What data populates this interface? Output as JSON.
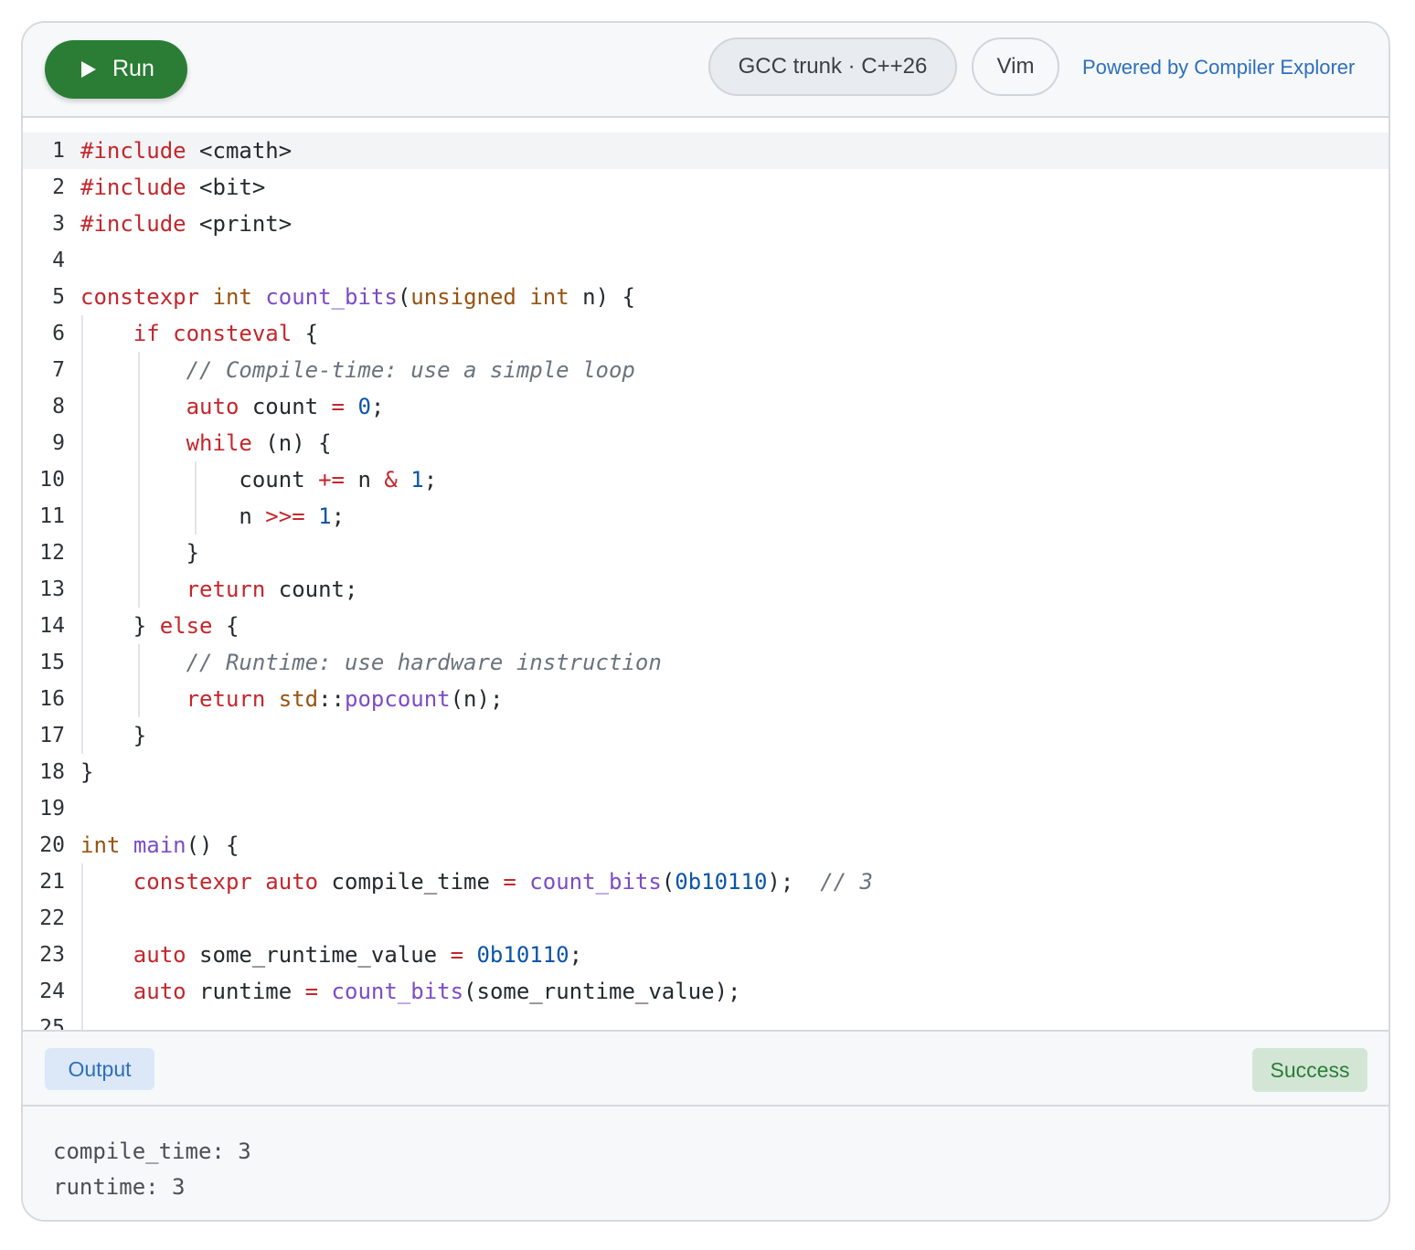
{
  "toolbar": {
    "run_label": "Run",
    "compiler_label": "GCC trunk · C++26",
    "vim_label": "Vim",
    "powered_by": "Powered by Compiler Explorer"
  },
  "editor": {
    "active_line": 1,
    "lines": [
      {
        "n": "1",
        "tokens": [
          [
            "kw",
            "#include"
          ],
          [
            "",
            " <cmath>"
          ]
        ]
      },
      {
        "n": "2",
        "tokens": [
          [
            "kw",
            "#include"
          ],
          [
            "",
            " <bit>"
          ]
        ]
      },
      {
        "n": "3",
        "tokens": [
          [
            "kw",
            "#include"
          ],
          [
            "",
            " <print>"
          ]
        ]
      },
      {
        "n": "4",
        "tokens": []
      },
      {
        "n": "5",
        "tokens": [
          [
            "kw",
            "constexpr"
          ],
          [
            "",
            " "
          ],
          [
            "ty",
            "int"
          ],
          [
            "",
            " "
          ],
          [
            "fn",
            "count_bits"
          ],
          [
            "",
            "("
          ],
          [
            "ty",
            "unsigned"
          ],
          [
            "",
            " "
          ],
          [
            "ty",
            "int"
          ],
          [
            "",
            " n) {"
          ]
        ]
      },
      {
        "n": "6",
        "tokens": [
          [
            "",
            "    "
          ],
          [
            "kw",
            "if"
          ],
          [
            "",
            " "
          ],
          [
            "kw",
            "consteval"
          ],
          [
            "",
            " {"
          ]
        ]
      },
      {
        "n": "7",
        "tokens": [
          [
            "",
            "        "
          ],
          [
            "cm",
            "// Compile-time: use a simple loop"
          ]
        ]
      },
      {
        "n": "8",
        "tokens": [
          [
            "",
            "        "
          ],
          [
            "kw",
            "auto"
          ],
          [
            "",
            " count "
          ],
          [
            "op",
            "="
          ],
          [
            "",
            " "
          ],
          [
            "num",
            "0"
          ],
          [
            "",
            ";"
          ]
        ]
      },
      {
        "n": "9",
        "tokens": [
          [
            "",
            "        "
          ],
          [
            "kw",
            "while"
          ],
          [
            "",
            " (n) {"
          ]
        ]
      },
      {
        "n": "10",
        "tokens": [
          [
            "",
            "            count "
          ],
          [
            "op",
            "+="
          ],
          [
            "",
            " n "
          ],
          [
            "op",
            "&"
          ],
          [
            "",
            " "
          ],
          [
            "num",
            "1"
          ],
          [
            "",
            ";"
          ]
        ]
      },
      {
        "n": "11",
        "tokens": [
          [
            "",
            "            n "
          ],
          [
            "op",
            ">>="
          ],
          [
            "",
            " "
          ],
          [
            "num",
            "1"
          ],
          [
            "",
            ";"
          ]
        ]
      },
      {
        "n": "12",
        "tokens": [
          [
            "",
            "        }"
          ]
        ]
      },
      {
        "n": "13",
        "tokens": [
          [
            "",
            "        "
          ],
          [
            "kw",
            "return"
          ],
          [
            "",
            " count;"
          ]
        ]
      },
      {
        "n": "14",
        "tokens": [
          [
            "",
            "    } "
          ],
          [
            "kw",
            "else"
          ],
          [
            "",
            " {"
          ]
        ]
      },
      {
        "n": "15",
        "tokens": [
          [
            "",
            "        "
          ],
          [
            "cm",
            "// Runtime: use hardware instruction"
          ]
        ]
      },
      {
        "n": "16",
        "tokens": [
          [
            "",
            "        "
          ],
          [
            "kw",
            "return"
          ],
          [
            "",
            " "
          ],
          [
            "ty",
            "std"
          ],
          [
            "",
            "::"
          ],
          [
            "fn",
            "popcount"
          ],
          [
            "",
            "(n);"
          ]
        ]
      },
      {
        "n": "17",
        "tokens": [
          [
            "",
            "    }"
          ]
        ]
      },
      {
        "n": "18",
        "tokens": [
          [
            "",
            "}"
          ]
        ]
      },
      {
        "n": "19",
        "tokens": []
      },
      {
        "n": "20",
        "tokens": [
          [
            "ty",
            "int"
          ],
          [
            "",
            " "
          ],
          [
            "fn",
            "main"
          ],
          [
            "",
            "() {"
          ]
        ]
      },
      {
        "n": "21",
        "tokens": [
          [
            "",
            "    "
          ],
          [
            "kw",
            "constexpr"
          ],
          [
            "",
            " "
          ],
          [
            "kw",
            "auto"
          ],
          [
            "",
            " compile_time "
          ],
          [
            "op",
            "="
          ],
          [
            "",
            " "
          ],
          [
            "fn",
            "count_bits"
          ],
          [
            "",
            "("
          ],
          [
            "num",
            "0b10110"
          ],
          [
            "",
            ");  "
          ],
          [
            "cm",
            "// 3"
          ]
        ]
      },
      {
        "n": "22",
        "tokens": []
      },
      {
        "n": "23",
        "tokens": [
          [
            "",
            "    "
          ],
          [
            "kw",
            "auto"
          ],
          [
            "",
            " some_runtime_value "
          ],
          [
            "op",
            "="
          ],
          [
            "",
            " "
          ],
          [
            "num",
            "0b10110"
          ],
          [
            "",
            ";"
          ]
        ]
      },
      {
        "n": "24",
        "tokens": [
          [
            "",
            "    "
          ],
          [
            "kw",
            "auto"
          ],
          [
            "",
            " runtime "
          ],
          [
            "op",
            "="
          ],
          [
            "",
            " "
          ],
          [
            "fn",
            "count_bits"
          ],
          [
            "",
            "(some_runtime_value);"
          ]
        ]
      },
      {
        "n": "25",
        "tokens": []
      }
    ]
  },
  "output": {
    "tab_label": "Output",
    "status_label": "Success",
    "lines": [
      "compile_time: 3",
      "runtime: 3"
    ]
  }
}
